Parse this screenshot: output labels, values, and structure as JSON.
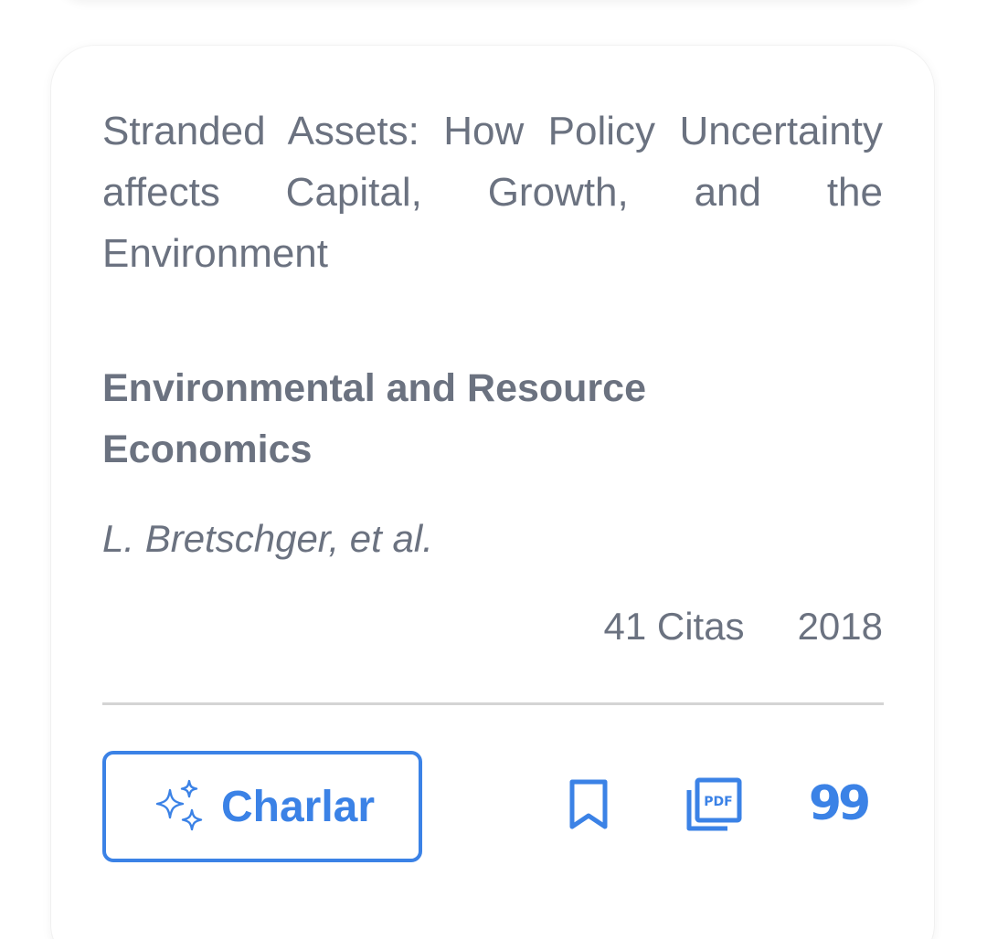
{
  "paper": {
    "title": "Stranded Assets: How Policy Uncertainty affects Capital, Growth, and the Environment",
    "journal": "Environmental and Resource Economics",
    "authors": "L. Bretschger, et al.",
    "citations": "41 Citas",
    "year": "2018"
  },
  "actions": {
    "chat_label": "Charlar",
    "chat_icon": "sparkles-icon",
    "bookmark_icon": "bookmark-icon",
    "pdf_icon": "pdf-icon",
    "pdf_icon_text": "PDF",
    "cite_icon": "quote-icon",
    "cite_glyph": "99"
  },
  "colors": {
    "accent": "#3b82e6",
    "text_muted": "#6b7280",
    "divider": "#d4d4d4"
  }
}
